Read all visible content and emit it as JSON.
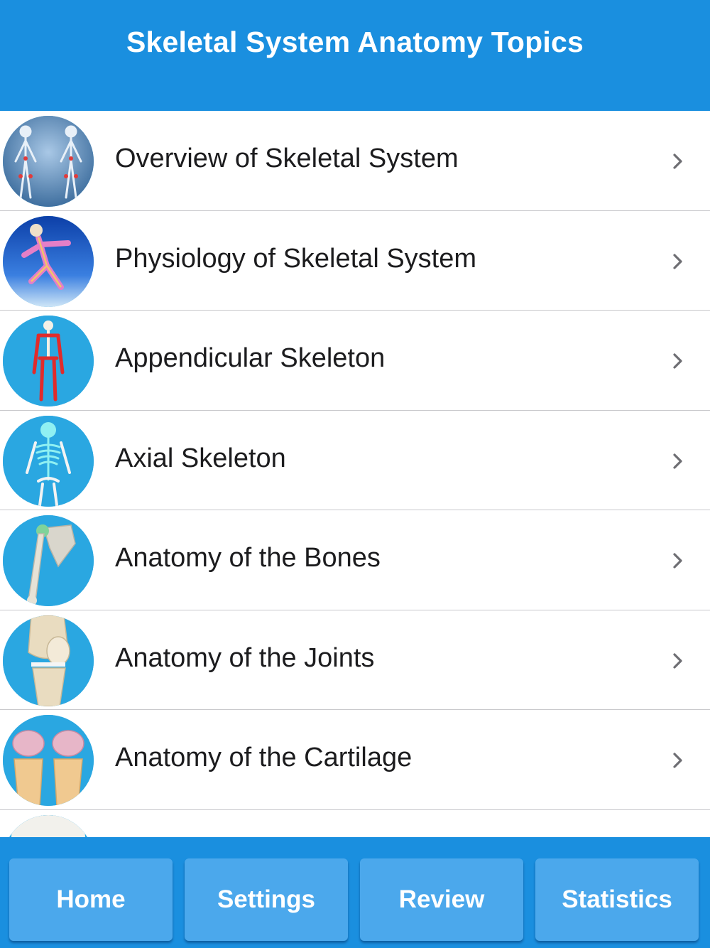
{
  "header": {
    "title": "Skeletal System Anatomy Topics"
  },
  "topics": [
    {
      "label": "Overview of Skeletal System",
      "icon": "skeleton-overview-thumbnail"
    },
    {
      "label": "Physiology of Skeletal System",
      "icon": "running-skeleton-thumbnail"
    },
    {
      "label": "Appendicular Skeleton",
      "icon": "appendicular-skeleton-thumbnail"
    },
    {
      "label": "Axial Skeleton",
      "icon": "axial-skeleton-thumbnail"
    },
    {
      "label": "Anatomy of the Bones",
      "icon": "humerus-bone-thumbnail"
    },
    {
      "label": "Anatomy of the Joints",
      "icon": "knee-joint-thumbnail"
    },
    {
      "label": "Anatomy of the Cartilage",
      "icon": "knee-cartilage-thumbnail"
    },
    {
      "label": "",
      "icon": "bone-head-thumbnail"
    }
  ],
  "tabbar": {
    "home": "Home",
    "settings": "Settings",
    "review": "Review",
    "statistics": "Statistics"
  },
  "colors": {
    "header_bg": "#1a8fdf",
    "tab_button_bg": "#4ba8ec",
    "thumbnail_bg": "#2aa7e1",
    "separator": "#c8c8cc"
  }
}
